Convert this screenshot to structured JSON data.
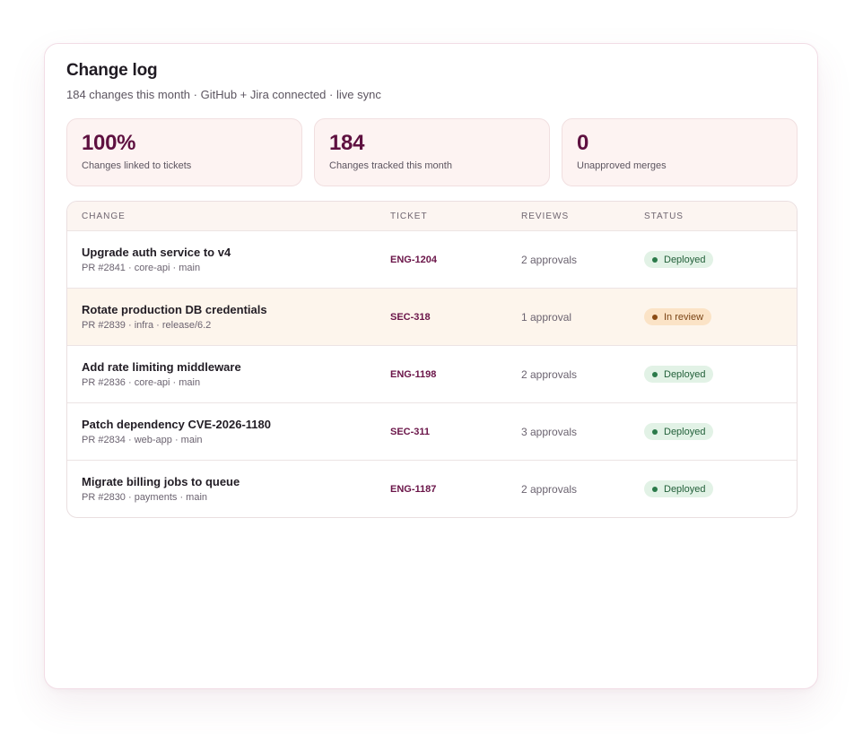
{
  "header": {
    "title": "Change log",
    "subtitle": "184 changes this month · GitHub + Jira connected · live sync"
  },
  "stats": [
    {
      "value": "100%",
      "label": "Changes linked to tickets"
    },
    {
      "value": "184",
      "label": "Changes tracked this month"
    },
    {
      "value": "0",
      "label": "Unapproved merges"
    }
  ],
  "table": {
    "columns": [
      "Change",
      "Ticket",
      "Reviews",
      "Status"
    ],
    "rows": [
      {
        "title": "Upgrade auth service to v4",
        "meta": "PR #2841 · core-api · main",
        "ticket": "ENG-1204",
        "reviews": "2 approvals",
        "status": "Deployed",
        "status_kind": "ok"
      },
      {
        "title": "Rotate production DB credentials",
        "meta": "PR #2839 · infra · release/6.2",
        "ticket": "SEC-318",
        "reviews": "1 approval",
        "status": "In review",
        "status_kind": "review"
      },
      {
        "title": "Add rate limiting middleware",
        "meta": "PR #2836 · core-api · main",
        "ticket": "ENG-1198",
        "reviews": "2 approvals",
        "status": "Deployed",
        "status_kind": "ok"
      },
      {
        "title": "Patch dependency CVE-2026-1180",
        "meta": "PR #2834 · web-app · main",
        "ticket": "SEC-311",
        "reviews": "3 approvals",
        "status": "Deployed",
        "status_kind": "ok"
      },
      {
        "title": "Migrate billing jobs to queue",
        "meta": "PR #2830 · payments · main",
        "ticket": "ENG-1187",
        "reviews": "2 approvals",
        "status": "Deployed",
        "status_kind": "ok"
      }
    ]
  },
  "colors": {
    "accent": "#5e1040",
    "deployed_bg": "#e2f2e6",
    "in_review_bg": "#fbe3c6",
    "highlight_row": "#fdf5ec"
  }
}
